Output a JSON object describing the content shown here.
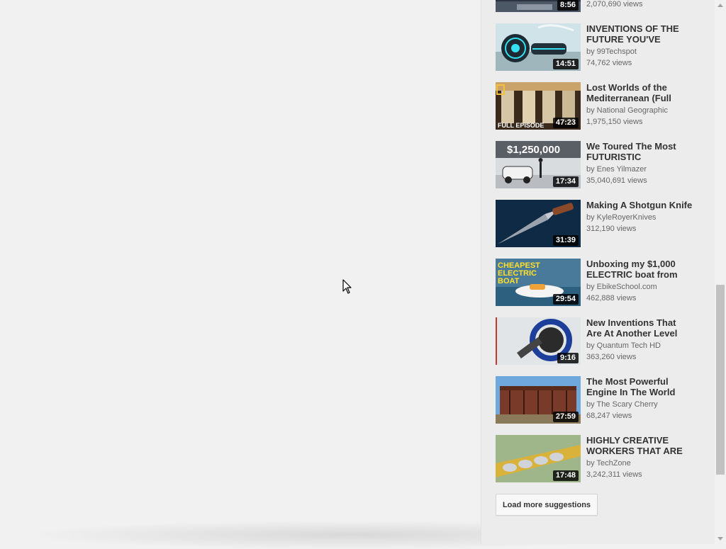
{
  "partial_item": {
    "views": "2,070,690 views",
    "duration": "8:56"
  },
  "suggestions": [
    {
      "title": "INVENTIONS OF THE FUTURE YOU'VE",
      "author": "by 99Techspot",
      "views": "74,762 views",
      "duration": "14:51",
      "thumb_icon": "futuristic-vehicle-thumbnail"
    },
    {
      "title": "Lost Worlds of the Mediterranean (Full",
      "author": "by National Geographic",
      "views": "1,975,150 views",
      "duration": "47:23",
      "thumb_icon": "greek-statues-thumbnail",
      "thumb_caption": "FULL EPISODE"
    },
    {
      "title": "We Toured The Most FUTURISTIC",
      "author": "by Enes Yilmazer",
      "views": "35,040,691 views",
      "duration": "17:34",
      "thumb_icon": "luxury-garage-thumbnail",
      "thumb_caption": "$1,250,000"
    },
    {
      "title": "Making A Shotgun Knife",
      "author": "by KyleRoyerKnives",
      "views": "312,190 views",
      "duration": "31:39",
      "thumb_icon": "knife-thumbnail"
    },
    {
      "title": "Unboxing my $1,000 ELECTRIC boat from",
      "author": "by EbikeSchool.com",
      "views": "462,888 views",
      "duration": "29:54",
      "thumb_icon": "electric-boat-thumbnail",
      "thumb_caption": "CHEAPEST ELECTRIC BOAT"
    },
    {
      "title": "New Inventions That Are At Another Level",
      "author": "by Quantum Tech HD",
      "views": "363,260 views",
      "duration": "9:16",
      "thumb_icon": "wheel-invention-thumbnail"
    },
    {
      "title": "The Most Powerful Engine In The World",
      "author": "by The Scary Cherry",
      "views": "68,247 views",
      "duration": "27:59",
      "thumb_icon": "ship-engine-thumbnail"
    },
    {
      "title": "HIGHLY CREATIVE WORKERS THAT ARE",
      "author": "by TechZone",
      "views": "3,242,311 views",
      "duration": "17:48",
      "thumb_icon": "machine-workers-thumbnail"
    }
  ],
  "load_more_label": "Load more suggestions",
  "colors": {
    "background": "#f1f1f1",
    "sidebar": "#ececec",
    "title_text": "#333333",
    "meta_text": "#666666",
    "duration_bg": "#000000"
  }
}
